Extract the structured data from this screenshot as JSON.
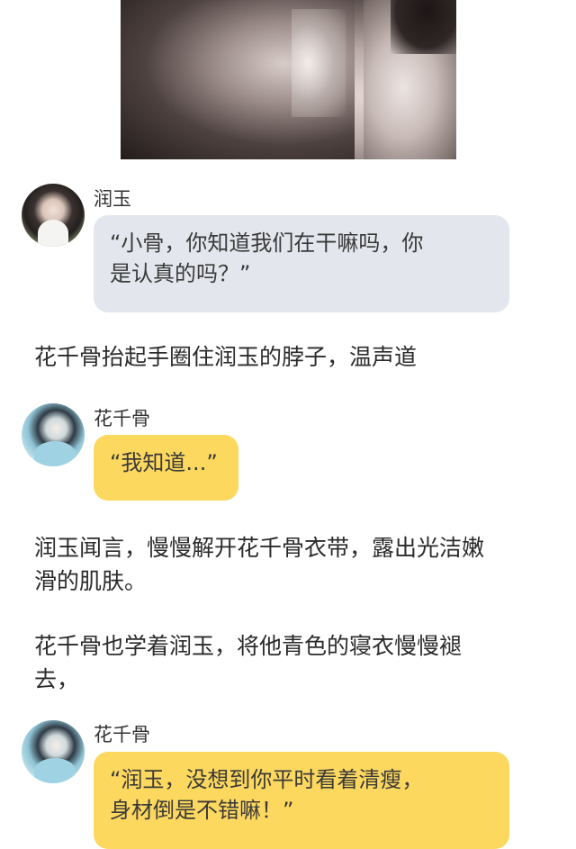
{
  "messages": [
    {
      "type": "image",
      "description_name": "hero-photo"
    },
    {
      "type": "chat",
      "speaker": "润玉",
      "text": "“小骨，你知道我们在干嘛吗，你是认真的吗？”",
      "line1": "“小骨，你知道我们在干嘛吗，你",
      "line2": "是认真的吗？”",
      "bubble_color": "#e3e6ec"
    },
    {
      "type": "narration",
      "text": "花千骨抬起手圈住润玉的脖子，温声道"
    },
    {
      "type": "chat",
      "speaker": "花千骨",
      "text": "“我知道...”",
      "bubble_color": "#fdd85f"
    },
    {
      "type": "narration",
      "line1": "润玉闻言，慢慢解开花千骨衣带，露出光洁嫩",
      "line2": "滑的肌肤。"
    },
    {
      "type": "narration",
      "line1": "花千骨也学着润玉，将他青色的寝衣慢慢褪",
      "line2": "去，"
    },
    {
      "type": "chat",
      "speaker": "花千骨",
      "line1": "“润玉，没想到你平时看着清瘦，",
      "line2": "身材倒是不错嘛！”",
      "bubble_color": "#fdd85f"
    }
  ]
}
